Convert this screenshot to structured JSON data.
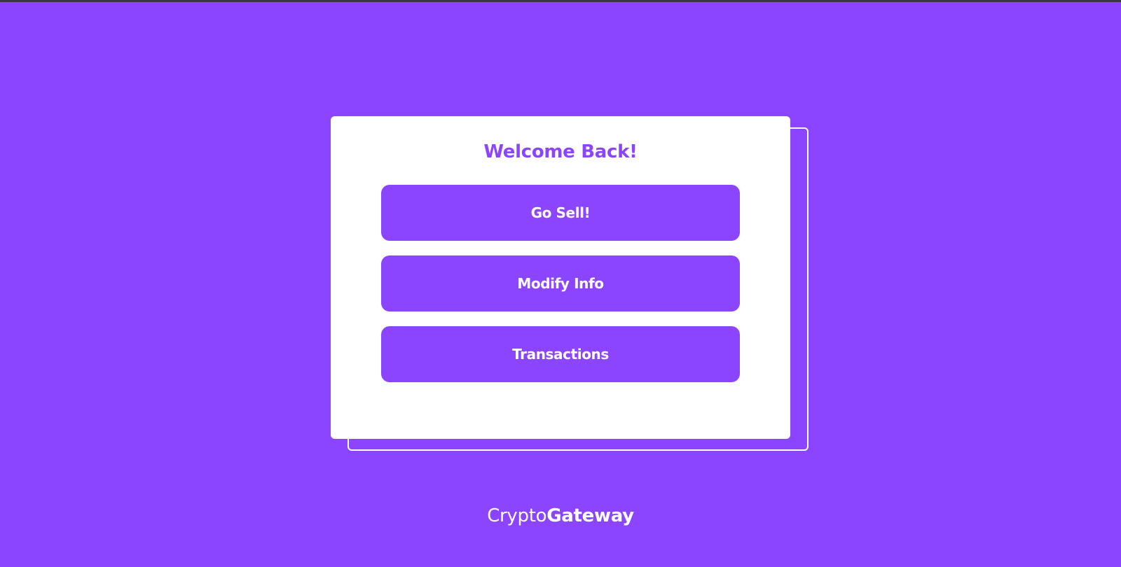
{
  "colors": {
    "background": "#8c45ff",
    "card": "#ffffff",
    "accent": "#8c45ff",
    "button_text": "#ffffff"
  },
  "card": {
    "title": "Welcome Back!",
    "buttons": [
      {
        "label": "Go Sell!"
      },
      {
        "label": "Modify Info"
      },
      {
        "label": "Transactions"
      }
    ]
  },
  "brand": {
    "light": "Crypto",
    "bold": "Gateway"
  }
}
